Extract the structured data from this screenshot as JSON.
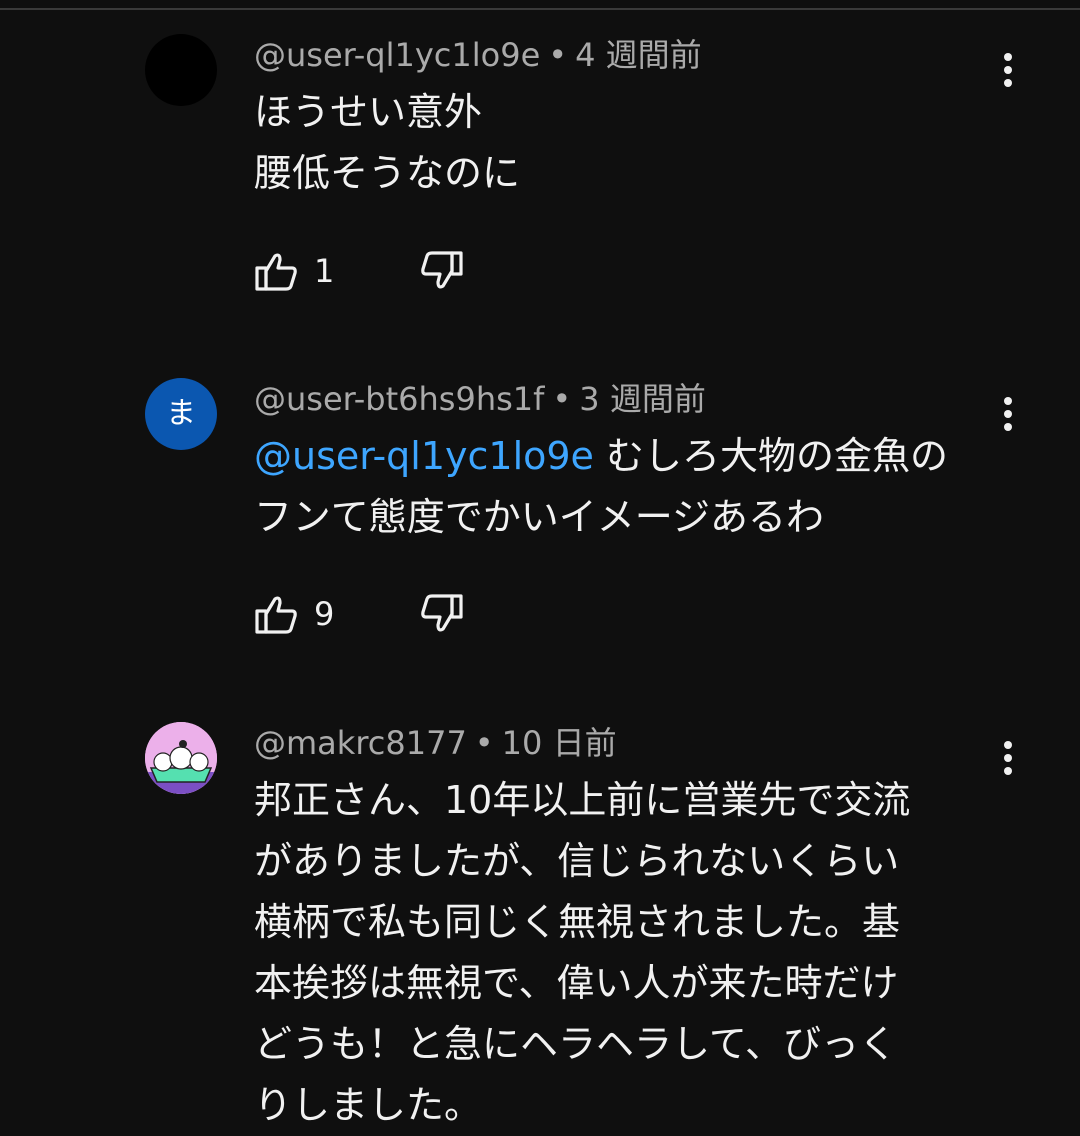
{
  "comments": [
    {
      "author": "@user-ql1yc1lo9e",
      "separator": "•",
      "time": "4 週間前",
      "avatar_color": "#000000",
      "avatar_letter": "",
      "mention": "",
      "lines": [
        "ほうせい意外",
        "腰低そうなのに"
      ],
      "likes": "1",
      "icons": {
        "like": "thumb-up-icon",
        "dislike": "thumb-down-icon",
        "menu": "more-vert-icon"
      }
    },
    {
      "author": "@user-bt6hs9hs1f",
      "separator": "•",
      "time": "3 週間前",
      "avatar_color": "#0b57b0",
      "avatar_letter": "ま",
      "mention": "@user-ql1yc1lo9e",
      "lines": [
        " むしろ大物の金魚の",
        "フンて態度でかいイメージあるわ"
      ],
      "likes": "9",
      "icons": {
        "like": "thumb-up-icon",
        "dislike": "thumb-down-icon",
        "menu": "more-vert-icon"
      }
    },
    {
      "author": "@makrc8177",
      "separator": "•",
      "time": "10 日前",
      "avatar_color": "#e8a6e6",
      "avatar_letter": "",
      "mention": "",
      "lines": [
        "邦正さん、10年以上前に営業先で交流",
        "がありましたが、信じられないくらい",
        "横柄で私も同じく無視されました。基",
        "本挨拶は無視で、偉い人が来た時だけ",
        "どうも！と急にヘラヘラして、びっく",
        "りしました。"
      ],
      "likes": "",
      "icons": {
        "like": "thumb-up-icon",
        "dislike": "thumb-down-icon",
        "menu": "more-vert-icon"
      }
    }
  ]
}
